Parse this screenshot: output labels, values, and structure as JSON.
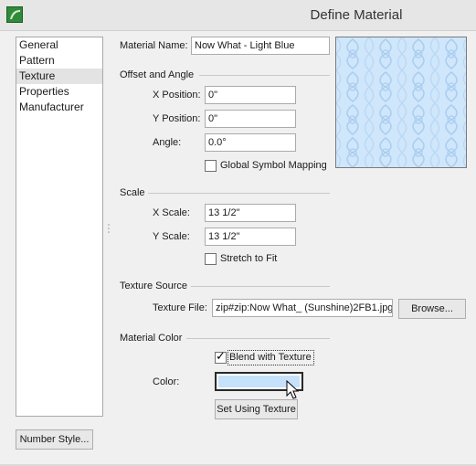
{
  "window": {
    "title": "Define Material",
    "icon": "app-logo-icon"
  },
  "sidebar": {
    "items": [
      {
        "label": "General"
      },
      {
        "label": "Pattern"
      },
      {
        "label": "Texture"
      },
      {
        "label": "Properties"
      },
      {
        "label": "Manufacturer"
      }
    ],
    "selected": "Texture",
    "number_style_button": "Number Style..."
  },
  "material_name": {
    "label": "Material Name:",
    "value": "Now What - Light  Blue"
  },
  "offset_angle": {
    "section_title": "Offset and Angle",
    "x_position_label": "X Position:",
    "x_position_value": "0\"",
    "y_position_label": "Y Position:",
    "y_position_value": "0\"",
    "angle_label": "Angle:",
    "angle_value": "0.0°",
    "global_symbol_mapping_label": "Global Symbol Mapping",
    "global_symbol_mapping_checked": false
  },
  "scale": {
    "section_title": "Scale",
    "x_scale_label": "X Scale:",
    "x_scale_value": "13 1/2\"",
    "y_scale_label": "Y Scale:",
    "y_scale_value": "13 1/2\"",
    "stretch_to_fit_label": "Stretch to Fit",
    "stretch_to_fit_checked": false
  },
  "texture_source": {
    "section_title": "Texture Source",
    "texture_file_label": "Texture File:",
    "texture_file_value": "zip#zip:Now What_ (Sunshine)2FB1.jpg",
    "browse_button": "Browse..."
  },
  "material_color": {
    "section_title": "Material Color",
    "blend_with_texture_label": "Blend with Texture",
    "blend_with_texture_checked": true,
    "color_label": "Color:",
    "color_value": "#c6e1fa",
    "set_using_texture_button": "Set Using Texture"
  },
  "colors": {
    "texture_base": "#cfe6fb",
    "texture_pattern": "#a9cdf0"
  }
}
